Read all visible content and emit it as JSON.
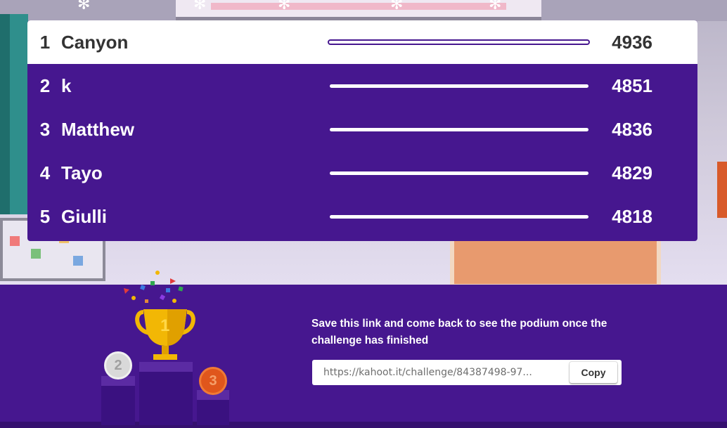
{
  "leaderboard": {
    "rows": [
      {
        "rank": "1",
        "name": "Canyon",
        "score": "4936"
      },
      {
        "rank": "2",
        "name": "k",
        "score": "4851"
      },
      {
        "rank": "3",
        "name": "Matthew",
        "score": "4836"
      },
      {
        "rank": "4",
        "name": "Tayo",
        "score": "4829"
      },
      {
        "rank": "5",
        "name": "Giulli",
        "score": "4818"
      }
    ]
  },
  "podium": {
    "first_label": "1",
    "second_label": "2",
    "third_label": "3"
  },
  "share": {
    "message": "Save this link and come back to see the podium once the challenge has finished",
    "link": "https://kahoot.it/challenge/84387498-97...",
    "copy_label": "Copy"
  },
  "colors": {
    "purple": "#46178f",
    "white": "#ffffff",
    "gold": "#f2b705",
    "silver": "#d9d9d9",
    "bronze": "#e0561c"
  }
}
